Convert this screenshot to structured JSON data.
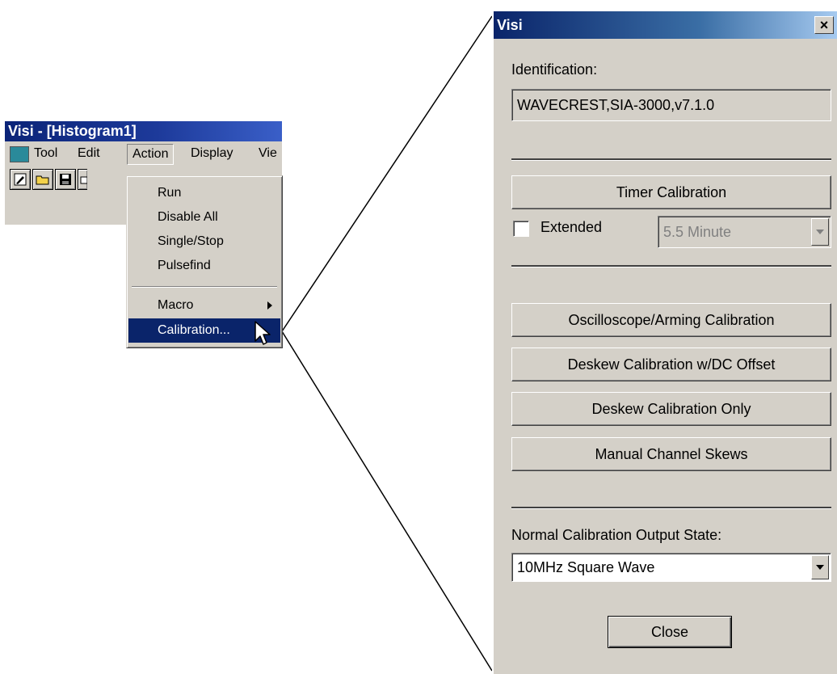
{
  "app_window": {
    "title": "Visi - [Histogram1]",
    "menu": {
      "tool": "Tool",
      "edit": "Edit",
      "action": "Action",
      "display": "Display",
      "view_partial": "Vie"
    },
    "toolbar_icons": [
      "wizard-icon",
      "open-folder-icon",
      "save-disk-icon",
      "printer-icon"
    ]
  },
  "action_menu": {
    "items": [
      "Run",
      "Disable All",
      "Single/Stop",
      "Pulsefind"
    ],
    "macro": "Macro",
    "calibration": "Calibration..."
  },
  "dialog": {
    "title": "Visi",
    "close_glyph": "×",
    "identification_label": "Identification:",
    "identification_value": "WAVECREST,SIA-3000,v7.1.0",
    "timer_calibration": "Timer Calibration",
    "extended_label": "Extended",
    "extended_checked": false,
    "extended_duration": "5.5 Minute",
    "oscilloscope_arming": "Oscilloscope/Arming Calibration",
    "deskew_dc": "Deskew Calibration w/DC Offset",
    "deskew_only": "Deskew Calibration Only",
    "manual_skews": "Manual Channel Skews",
    "output_state_label": "Normal Calibration Output State:",
    "output_state_value": "10MHz Square Wave",
    "close_button": "Close"
  },
  "colors": {
    "face": "#d4d0c8",
    "highlight": "#0a246a",
    "disabled_text": "#808080"
  }
}
